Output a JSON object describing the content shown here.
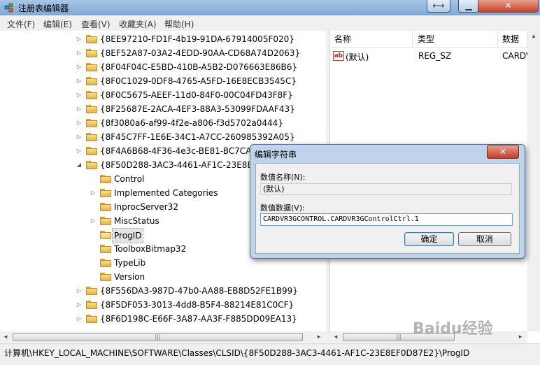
{
  "window": {
    "title": "注册表编辑器",
    "buttons": {
      "restore": "⟷",
      "minimize": "▁",
      "close": "✕"
    }
  },
  "menu": [
    "文件(F)",
    "编辑(E)",
    "查看(V)",
    "收藏夹(A)",
    "帮助(H)"
  ],
  "tree": {
    "items": [
      {
        "label": "{8EE97210-FD1F-4b19-91DA-67914005F020}",
        "level": 1,
        "expander": "▷"
      },
      {
        "label": "{8EF52A87-03A2-4EDD-90AA-CD68A74D2063}",
        "level": 1,
        "expander": "▷"
      },
      {
        "label": "{8F04F04C-E5BD-410B-A5B2-D076663E86B6}",
        "level": 1,
        "expander": "▷"
      },
      {
        "label": "{8F0C1029-0DF8-4765-A5FD-16E8ECB3545C}",
        "level": 1,
        "expander": "▷"
      },
      {
        "label": "{8F0C5675-AEEF-11d0-84F0-00C04FD43F8F}",
        "level": 1,
        "expander": "▷"
      },
      {
        "label": "{8F25687E-2ACA-4EF3-88A3-53099FDAAF43}",
        "level": 1,
        "expander": "▷"
      },
      {
        "label": "{8f3080a6-af99-4f2e-a806-f3d5702a0444}",
        "level": 1,
        "expander": "▷"
      },
      {
        "label": "{8F45C7FF-1E6E-34C1-A7CC-260985392A05}",
        "level": 1,
        "expander": "▷"
      },
      {
        "label": "{8F4A6B68-4F36-4e3c-BE81-BC7CA4E9C45C}",
        "level": 1,
        "expander": "▷"
      },
      {
        "label": "{8F50D288-3AC3-4461-AF1C-23E8EF0D87E2}",
        "level": 1,
        "expander": "◢"
      },
      {
        "label": "Control",
        "level": 2,
        "expander": ""
      },
      {
        "label": "Implemented Categories",
        "level": 2,
        "expander": "▷"
      },
      {
        "label": "InprocServer32",
        "level": 2,
        "expander": ""
      },
      {
        "label": "MiscStatus",
        "level": 2,
        "expander": "▷"
      },
      {
        "label": "ProgID",
        "level": 2,
        "expander": "",
        "selected": true
      },
      {
        "label": "ToolboxBitmap32",
        "level": 2,
        "expander": ""
      },
      {
        "label": "TypeLib",
        "level": 2,
        "expander": ""
      },
      {
        "label": "Version",
        "level": 2,
        "expander": ""
      },
      {
        "label": "{8F556DA3-987D-47b0-AA88-EB8D52FE1B99}",
        "level": 1,
        "expander": "▷"
      },
      {
        "label": "{8F5DF053-3013-4dd8-B5F4-88214E81C0CF}",
        "level": 1,
        "expander": "▷"
      },
      {
        "label": "{8F6D198C-E66F-3A87-AA3F-F885DD09EA13}",
        "level": 1,
        "expander": "▷"
      }
    ]
  },
  "list": {
    "columns": [
      "名称",
      "类型",
      "数据"
    ],
    "rows": [
      {
        "name": "(默认)",
        "type": "REG_SZ",
        "data": "CARDV"
      }
    ],
    "icon": "ab"
  },
  "dialog": {
    "title": "编辑字符串",
    "close": "✕",
    "name_label": "数值名称(N):",
    "name_value": "(默认)",
    "data_label": "数值数据(V):",
    "data_value": "CARDVR3GCONTROL.CARDVR3GControlCtrl.1",
    "ok": "确定",
    "cancel": "取消"
  },
  "scroll": {
    "left": "◂",
    "right": "▸",
    "up": "▴",
    "grip": "|||"
  },
  "status": "计算机\\HKEY_LOCAL_MACHINE\\SOFTWARE\\Classes\\CLSID\\{8F50D288-3AC3-4461-AF1C-23E8EF0D87E2}\\ProgID",
  "watermark": "Baidu经验"
}
